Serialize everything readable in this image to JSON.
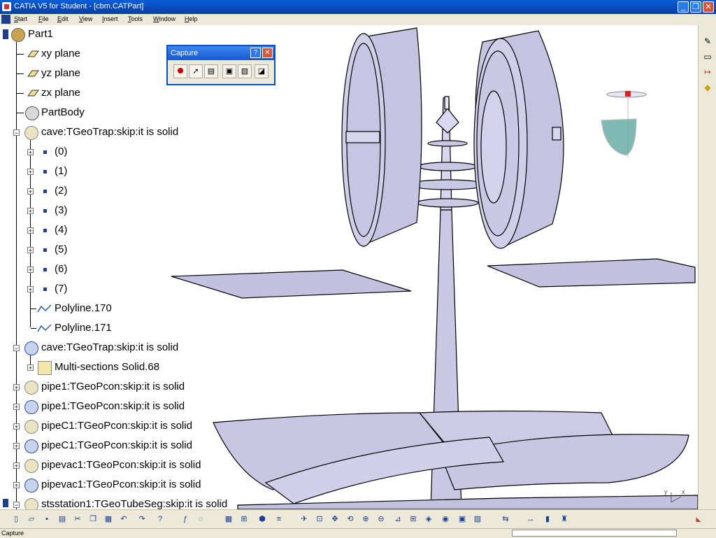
{
  "window": {
    "title": "CATIA V5 for Student - [cbm.CATPart]",
    "buttons": {
      "minimize": "_",
      "restore": "❐",
      "close": "✕"
    }
  },
  "menu": [
    "Start",
    "File",
    "Edit",
    "View",
    "Insert",
    "Tools",
    "Window",
    "Help"
  ],
  "tree": {
    "root": "Part1",
    "planes": [
      "xy plane",
      "yz plane",
      "zx plane"
    ],
    "body": "PartBody",
    "cave1": "cave:TGeoTrap:skip:it is solid",
    "cave1_children": [
      "(0)",
      "(1)",
      "(2)",
      "(3)",
      "(4)",
      "(5)",
      "(6)",
      "(7)"
    ],
    "polylines": [
      "Polyline.170",
      "Polyline.171"
    ],
    "cave2": "cave:TGeoTrap:skip:it is solid",
    "multisection": "Multi-sections Solid.68",
    "more": [
      "pipe1:TGeoPcon:skip:it is solid",
      "pipe1:TGeoPcon:skip:it is solid",
      "pipeC1:TGeoPcon:skip:it is solid",
      "pipeC1:TGeoPcon:skip:it is solid",
      "pipevac1:TGeoPcon:skip:it is solid",
      "pipevac1:TGeoPcon:skip:it is solid",
      "stsstation1:TGeoTubeSeg:skip:it is solid"
    ]
  },
  "capture_panel": {
    "title": "Capture",
    "help": "?",
    "close": "✕",
    "tools": [
      "record-icon",
      "select-icon",
      "options-icon",
      "capture-icon",
      "album-icon",
      "capture-mode-icon"
    ]
  },
  "status": {
    "text": "Capture"
  },
  "colors": {
    "model_fill": "#c9c9e6",
    "model_stroke": "#000000",
    "titlebar": "#0a5fd9",
    "toolbar": "#ece9d8"
  },
  "axis": {
    "x": "x",
    "y": "y"
  }
}
